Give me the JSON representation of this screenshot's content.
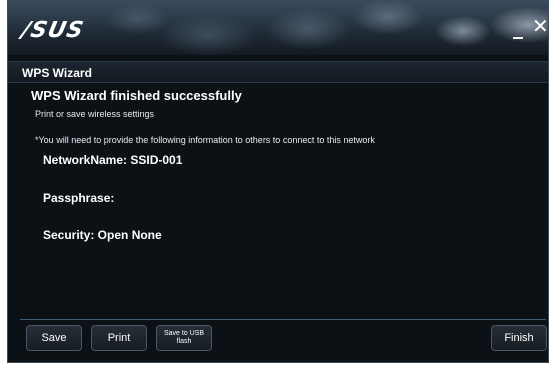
{
  "window": {
    "logo": "/SUS",
    "minimize": "_",
    "close": "✕"
  },
  "header": {
    "title": "WPS Wizard"
  },
  "content": {
    "title": "WPS Wizard finished successfully",
    "subtitle": "Print or save wireless settings",
    "note": "*You will need to provide the following information to others to connect to this network",
    "network_name": "NetworkName: SSID-001",
    "passphrase": "Passphrase:",
    "security": "Security: Open None"
  },
  "buttons": {
    "save": "Save",
    "print": "Print",
    "save_usb": "Save to USB flash",
    "finish": "Finish"
  }
}
